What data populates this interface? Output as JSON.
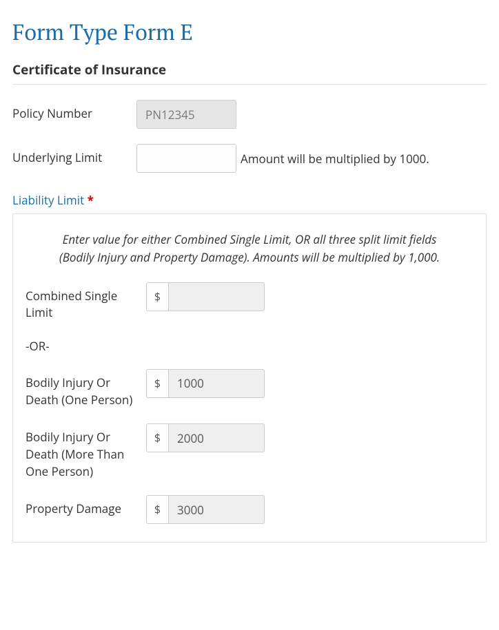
{
  "title": "Form Type Form E",
  "subtitle": "Certificate of Insurance",
  "fields": {
    "policy_number": {
      "label": "Policy Number",
      "value": "PN12345"
    },
    "underlying_limit": {
      "label": "Underlying Limit",
      "value": "",
      "hint": "Amount will be multiplied by 1000."
    }
  },
  "liability": {
    "legend": "Liability Limit",
    "required_mark": "*",
    "instructions": "Enter value for either Combined Single Limit, OR all three split limit fields (Bodily Injury and Property Damage). Amounts will be multiplied by 1,000.",
    "or_sep": "-OR-",
    "currency": "$",
    "combined": {
      "label": "Combined Single Limit",
      "value": ""
    },
    "bodily_one": {
      "label": "Bodily Injury Or Death (One Person)",
      "value": "1000"
    },
    "bodily_more": {
      "label": "Bodily Injury Or Death (More Than One Person)",
      "value": "2000"
    },
    "property": {
      "label": "Property Damage",
      "value": "3000"
    }
  }
}
